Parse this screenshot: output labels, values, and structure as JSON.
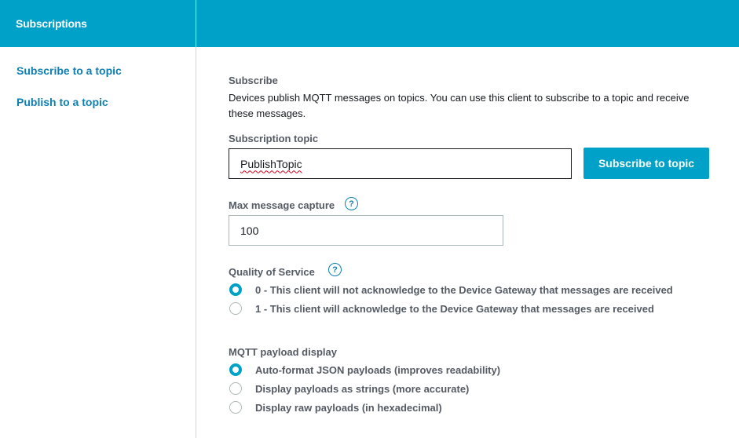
{
  "sidebar": {
    "title": "Subscriptions",
    "links": [
      {
        "label": "Subscribe to a topic"
      },
      {
        "label": "Publish to a topic"
      }
    ]
  },
  "subscribe": {
    "heading": "Subscribe",
    "description": "Devices publish MQTT messages on topics. You can use this client to subscribe to a topic and receive these messages.",
    "topic_label": "Subscription topic",
    "topic_value": "PublishTopic",
    "subscribe_button": "Subscribe to topic",
    "max_capture_label": "Max message capture",
    "max_capture_value": "100",
    "help_glyph": "?"
  },
  "qos": {
    "label": "Quality of Service",
    "options": [
      {
        "label": "0 - This client will not acknowledge to the Device Gateway that messages are received",
        "selected": true
      },
      {
        "label": "1 - This client will acknowledge to the Device Gateway that messages are received",
        "selected": false
      }
    ]
  },
  "payload": {
    "label": "MQTT payload display",
    "options": [
      {
        "label": "Auto-format JSON payloads (improves readability)",
        "selected": true
      },
      {
        "label": "Display payloads as strings (more accurate)",
        "selected": false
      },
      {
        "label": "Display raw payloads (in hexadecimal)",
        "selected": false
      }
    ]
  },
  "colors": {
    "accent": "#00a1c9",
    "link": "#0e7fb0",
    "label": "#545b64",
    "border": "#aab7b8"
  },
  "icons": {
    "help": "help-circle-icon"
  }
}
